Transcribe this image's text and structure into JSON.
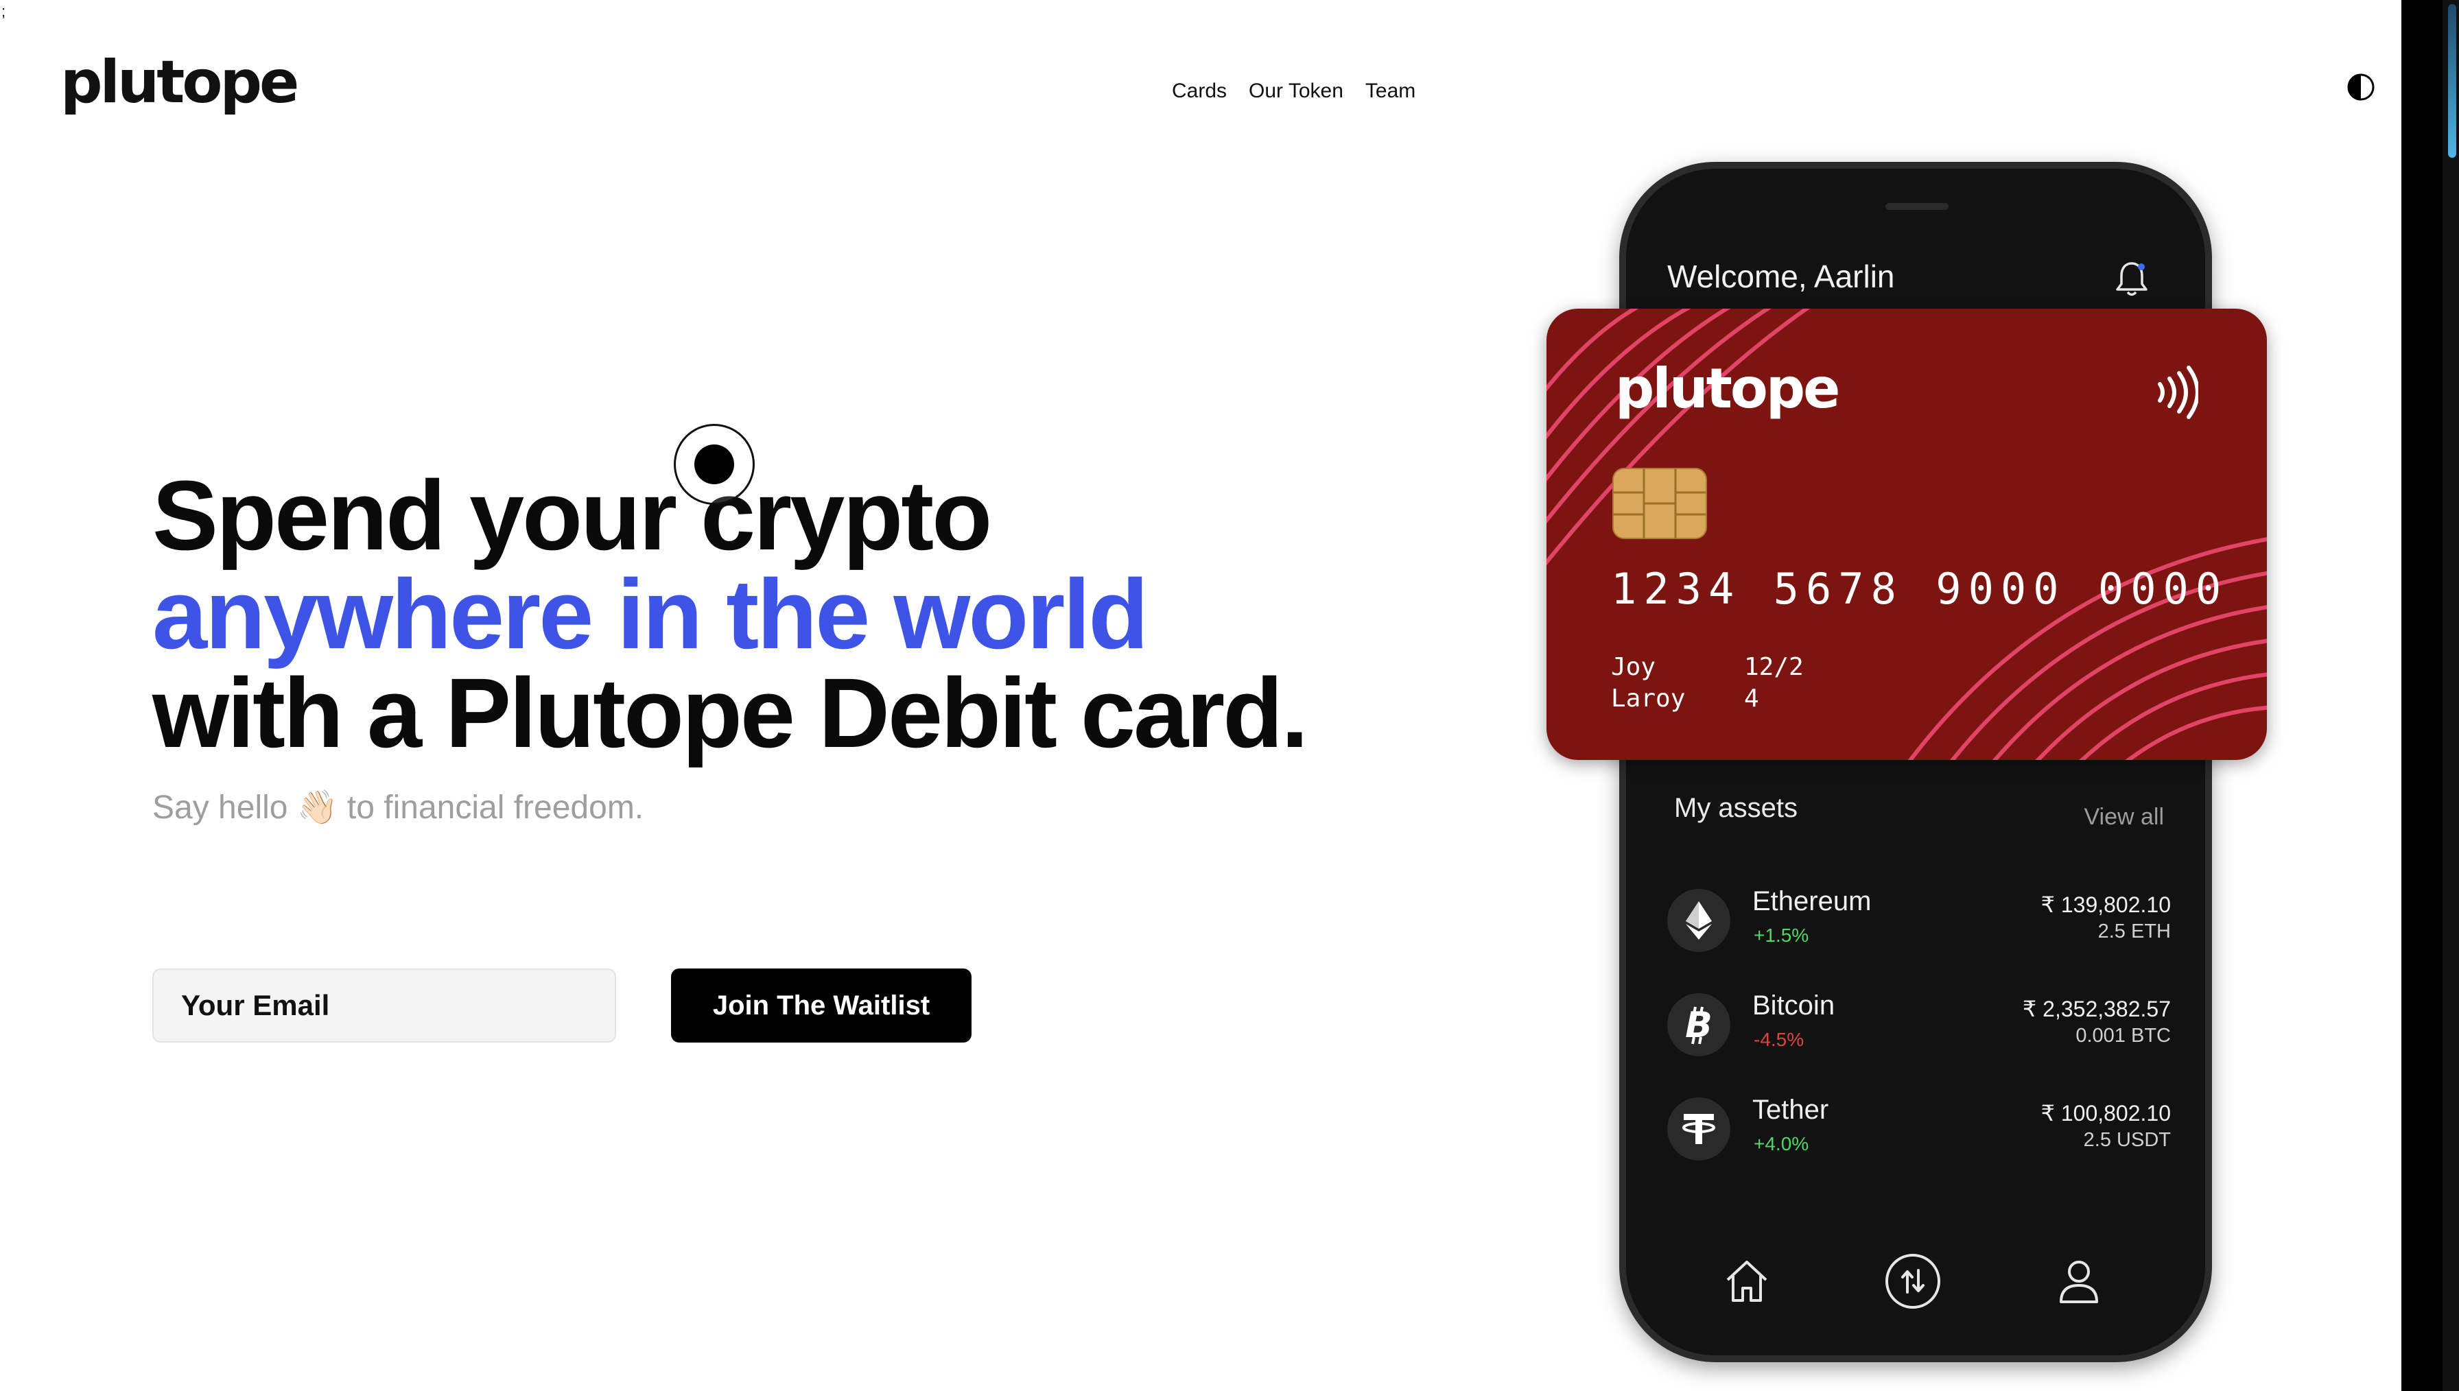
{
  "stray_char": ";",
  "header": {
    "logo": "plutope",
    "nav": [
      "Cards",
      "Our Token",
      "Team"
    ],
    "theme_toggle_icon": "contrast-icon"
  },
  "hero": {
    "line1": "Spend your crypto",
    "line2": "anywhere in the world",
    "line3": "with a Plutope Debit card.",
    "tagline": "Say hello 👋🏻 to financial freedom.",
    "email_placeholder": "Your Email",
    "cta": "Join The Waitlist",
    "accent_color": "#3d54e6"
  },
  "phone": {
    "welcome": "Welcome, Aarlin",
    "assets_title": "My assets",
    "view_all": "View all",
    "assets": [
      {
        "name": "Ethereum",
        "change": "+1.5%",
        "fiat": "₹ 139,802.10",
        "qty": "2.5 ETH",
        "icon": "ethereum-icon",
        "change_color": "#4cd964"
      },
      {
        "name": "Bitcoin",
        "change": "-4.5%",
        "fiat": "₹ 2,352,382.57",
        "qty": "0.001 BTC",
        "icon": "bitcoin-icon",
        "change_color": "#e0443a"
      },
      {
        "name": "Tether",
        "change": "+4.0%",
        "fiat": "₹ 100,802.10",
        "qty": "2.5 USDT",
        "icon": "tether-icon",
        "change_color": "#4cd964"
      }
    ],
    "nav_icons": [
      "home-icon",
      "transfer-icon",
      "profile-icon"
    ]
  },
  "card": {
    "logo": "plutope",
    "number": "1234 5678 9000 0000",
    "holder_first": "Joy",
    "holder_last": "Laroy",
    "exp_a": "12/2",
    "exp_b": "4",
    "color": "#7c1410"
  }
}
